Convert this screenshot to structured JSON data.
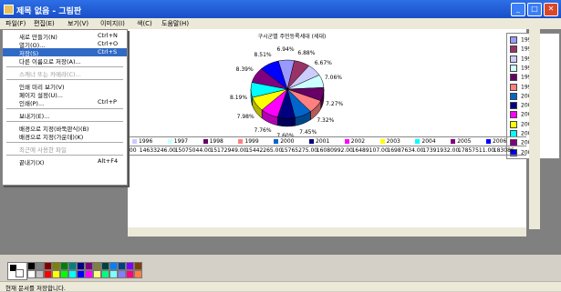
{
  "window": {
    "title": "제목 없음 - 그림판"
  },
  "menubar": [
    "파일(F)",
    "편집(E)",
    "보기(V)",
    "이미지(I)",
    "색(C)",
    "도움말(H)"
  ],
  "file_menu": [
    {
      "label": "새로 만들기(N)",
      "shortcut": "Ctrl+N"
    },
    {
      "label": "열기(O)...",
      "shortcut": "Ctrl+O"
    },
    {
      "label": "저장(S)",
      "shortcut": "Ctrl+S",
      "selected": true
    },
    {
      "label": "다른 이름으로 저장(A)..."
    },
    {
      "sep": true
    },
    {
      "label": "스캐너 또는 카메라(C)...",
      "disabled": true
    },
    {
      "sep": true
    },
    {
      "label": "인쇄 미리 보기(V)"
    },
    {
      "label": "페이지 설정(U)..."
    },
    {
      "label": "인쇄(P)...",
      "shortcut": "Ctrl+P"
    },
    {
      "sep": true
    },
    {
      "label": "보내기(E)..."
    },
    {
      "sep": true
    },
    {
      "label": "배경으로 지정(바둑판식)(B)"
    },
    {
      "label": "배경으로 지정(가운데)(K)"
    },
    {
      "sep": true
    },
    {
      "label": "최근에 사용한 파일",
      "disabled": true
    },
    {
      "sep": true
    },
    {
      "label": "끝내기(X)",
      "shortcut": "Alt+F4"
    }
  ],
  "chart_data": {
    "type": "pie",
    "title": "구시군별 주민등록세대 (세대)",
    "categories": [
      "1994",
      "1995",
      "1996",
      "1997",
      "1998",
      "1999",
      "2000",
      "2001",
      "2002",
      "2003",
      "2004",
      "2005",
      "2006"
    ],
    "values": [
      6.94,
      6.88,
      6.67,
      7.06,
      7.27,
      7.32,
      7.45,
      7.6,
      7.76,
      7.98,
      8.19,
      8.39,
      8.51
    ],
    "label_texts": [
      "6.94%",
      "6.88%",
      "6.67%",
      "7.06%",
      "7.27%",
      "7.32%",
      "7.45%",
      "7.60%",
      "7.76%",
      "7.98%",
      "8.19%",
      "8.39%",
      "8.51%"
    ],
    "colors": [
      "#9999ff",
      "#993366",
      "#ccccff",
      "#ccffff",
      "#660066",
      "#ff8080",
      "#0066cc",
      "#000080",
      "#ff00ff",
      "#ffff00",
      "#00ffff",
      "#800080",
      "#0000ff"
    ],
    "legend": [
      "1994",
      "1995",
      "1996",
      "1997",
      "1998",
      "1999",
      "2000",
      "2001",
      "2002",
      "2003",
      "2004",
      "2005",
      "2006"
    ],
    "legend_colors": [
      "#9999ff",
      "#993366",
      "#ccccff",
      "#ccffff",
      "#660066",
      "#ff8080",
      "#0066cc",
      "#000080",
      "#ff00ff",
      "#ffff00",
      "#00ffff",
      "#800080",
      "#0000ff"
    ],
    "legend_placement": "right"
  },
  "data_table": {
    "headers": [
      "1996",
      "1997",
      "1998",
      "1999",
      "2000",
      "2001",
      "2002",
      "2003",
      "2004",
      "2005",
      "2006"
    ],
    "row": [
      ".00",
      "14633246.00",
      "15075044.00",
      "15172949.00",
      "15442265.00",
      "15765275.00",
      "16080992.00",
      "16489107.00",
      "16987634.00",
      "17391932.00",
      "17857511.00",
      "183086"
    ]
  },
  "palette": [
    "#000000",
    "#808080",
    "#800000",
    "#808000",
    "#008000",
    "#008080",
    "#000080",
    "#800080",
    "#808040",
    "#004040",
    "#0080ff",
    "#004080",
    "#8000ff",
    "#804000",
    "#ffffff",
    "#c0c0c0",
    "#ff0000",
    "#ffff00",
    "#00ff00",
    "#00ffff",
    "#0000ff",
    "#ff00ff",
    "#ffff80",
    "#00ff80",
    "#80ffff",
    "#8080ff",
    "#ff0080",
    "#ff8040"
  ],
  "status": "현재 문서를 저장합니다."
}
